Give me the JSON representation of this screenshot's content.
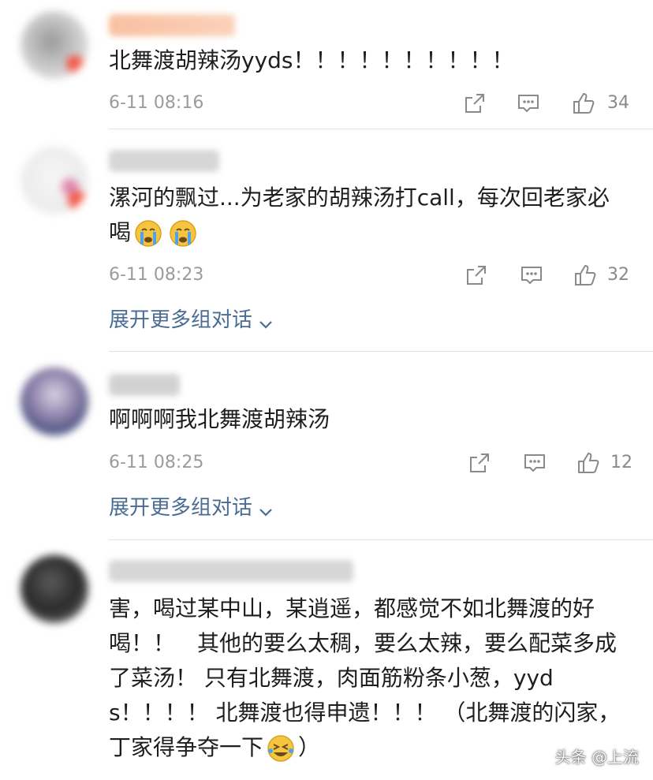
{
  "comments": [
    {
      "text": "北舞渡胡辣汤yyds！！！！！！！！！！",
      "time": "6-11 08:16",
      "likes": "34"
    },
    {
      "text_main": "漯河的飘过...为老家的胡辣汤打call，每次回老家必喝",
      "emoji": "crying-face-emoji",
      "time": "6-11 08:23",
      "likes": "32",
      "expand_label": "展开更多组对话"
    },
    {
      "text": "啊啊啊我北舞渡胡辣汤",
      "time": "6-11 08:25",
      "likes": "12",
      "expand_label": "展开更多组对话"
    },
    {
      "text_main": "害，喝过某中山，某逍遥，都感觉不如北舞渡的好喝！！　其他的要么太稠，要么太辣，要么配菜多成了菜汤！ 只有北舞渡，肉面筋粉条小葱，yyds！！！！ 北舞渡也得申遗！！！ （北舞渡的闪家，丁家得争夺一下",
      "text_end": "）",
      "emoji": "laughing-tears-emoji"
    }
  ],
  "watermark": "头条 @上流",
  "colors": {
    "link": "#4a6c94",
    "meta": "#9b9b9b",
    "icon": "#8a8a8a"
  }
}
